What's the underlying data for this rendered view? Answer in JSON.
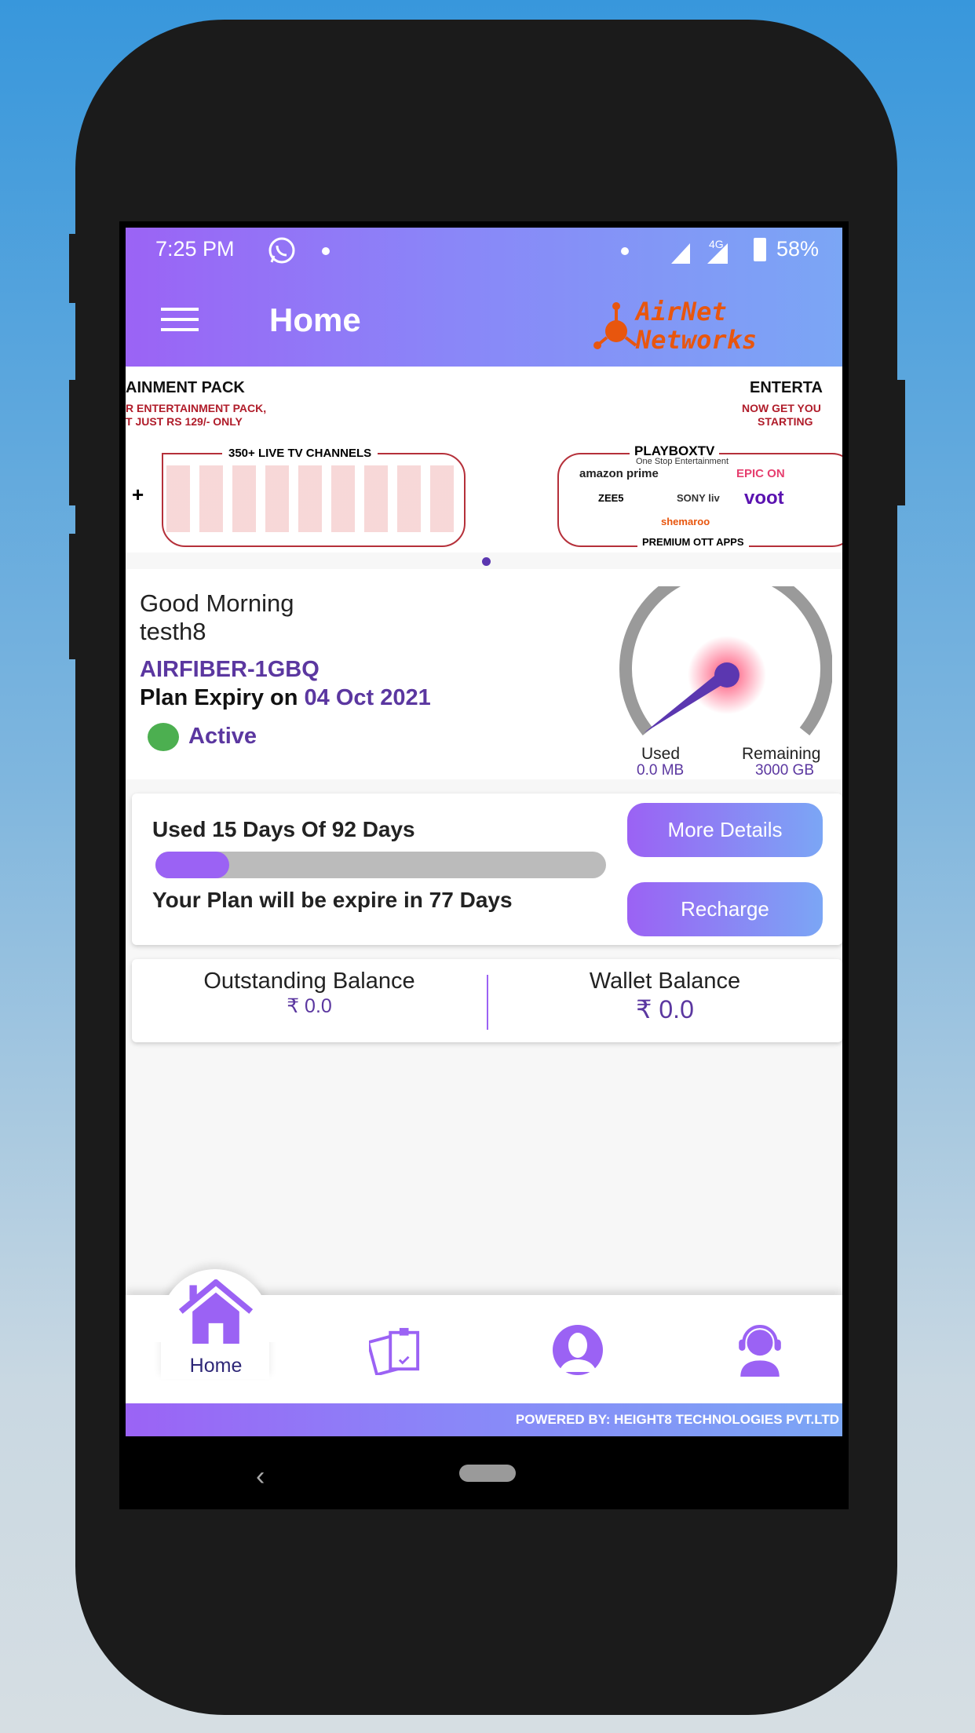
{
  "status_bar": {
    "time": "7:25 PM",
    "network": "4G",
    "battery": "58%"
  },
  "header": {
    "title": "Home",
    "logo_text": [
      "AirNet",
      "Networks"
    ],
    "menu_icon": "hamburger-icon",
    "logo_color": "#e8560e"
  },
  "banner": {
    "slide_left": {
      "title": "AINMENT PACK",
      "line1": "R ENTERTAINMENT PACK,",
      "line2": "T JUST RS 129/- ONLY",
      "box_title": "350+ LIVE TV CHANNELS",
      "plus": "+"
    },
    "slide_right": {
      "title": "ENTERTA",
      "line1": "NOW GET YOU",
      "line2": "STARTING",
      "brand": "PLAYBOXTV",
      "brand_tag": "One Stop Entertainment",
      "apps": [
        "amazon prime",
        "EPIC ON",
        "ZEE5",
        "SONY liv",
        "voot",
        "shemaroo"
      ],
      "box_footer": "PREMIUM OTT APPS"
    },
    "active_slide": 1,
    "slide_count": 1
  },
  "account": {
    "greeting": "Good Morning",
    "username": "testh8",
    "plan": "AIRFIBER-1GBQ",
    "expiry_label": "Plan Expiry on",
    "expiry_date": "04 Oct 2021",
    "status": "Active",
    "status_color": "#4caf50"
  },
  "gauge": {
    "used_label": "Used",
    "used_value": "0.0 MB",
    "remaining_label": "Remaining",
    "remaining_value": "3000 GB"
  },
  "plan": {
    "used_text": "Used 15 Days Of 92 Days",
    "progress_percent": 16.3,
    "expire_text": "Your Plan will be expire in 77 Days",
    "more_details": "More Details",
    "recharge": "Recharge"
  },
  "balance": {
    "outstanding_label": "Outstanding Balance",
    "outstanding_value": "₹ 0.0",
    "wallet_label": "Wallet Balance",
    "wallet_value": "₹ 0.0"
  },
  "bottom_nav": {
    "items": [
      {
        "label": "Home",
        "icon": "home-icon",
        "active": true
      },
      {
        "label": "",
        "icon": "clipboard-icon"
      },
      {
        "label": "",
        "icon": "user-profile-icon"
      },
      {
        "label": "",
        "icon": "support-headset-icon"
      }
    ]
  },
  "footer": {
    "powered_by": "POWERED BY: HEIGHT8 TECHNOLOGIES PVT.LTD"
  },
  "colors": {
    "accent": "#9b63f5",
    "accent_end": "#7ba6f5",
    "text_purple": "#5b37a0"
  }
}
